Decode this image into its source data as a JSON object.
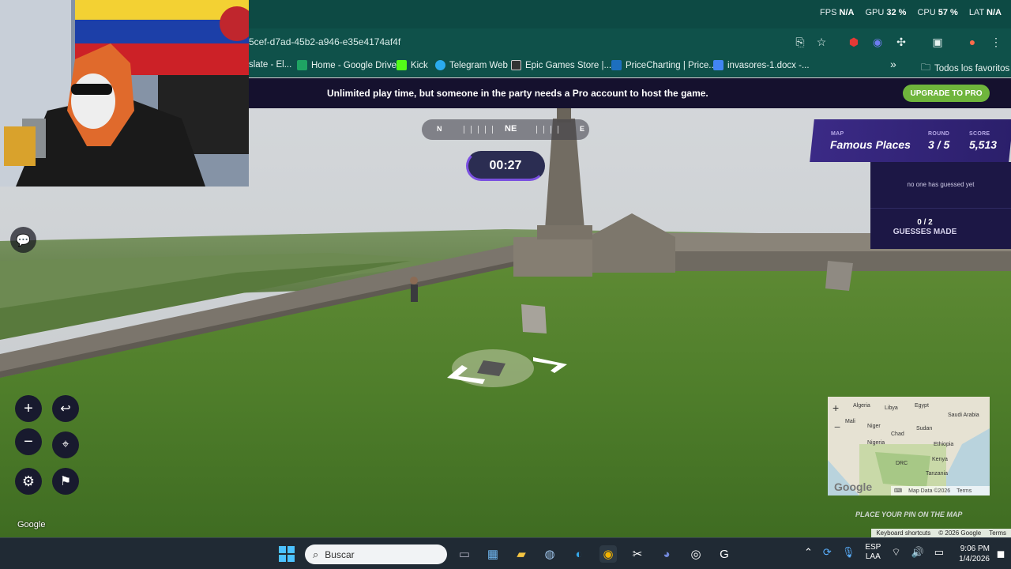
{
  "browser": {
    "url": "5cef-d7ad-45b2-a946-e35e4174af4f",
    "bookmarks": [
      {
        "label": "slate - El...",
        "icon": "bookmark-icon",
        "color": "#888888"
      },
      {
        "label": "Home - Google Drive",
        "icon": "google-drive-icon",
        "color": "#1fa463"
      },
      {
        "label": "Kick",
        "icon": "kick-icon",
        "color": "#53fc18"
      },
      {
        "label": "Telegram Web",
        "icon": "telegram-icon",
        "color": "#2aabee"
      },
      {
        "label": "Epic Games Store |...",
        "icon": "epic-games-icon",
        "color": "#333333"
      },
      {
        "label": "PriceCharting | Price...",
        "icon": "pricecharting-icon",
        "color": "#1d6fbf"
      },
      {
        "label": "invasores-1.docx -...",
        "icon": "docs-icon",
        "color": "#4285f4"
      }
    ],
    "more_label": "»",
    "all_favorites_label": "Todos los favoritos"
  },
  "perf": {
    "fps_label": "FPS",
    "fps_value": "N/A",
    "gpu_label": "GPU",
    "gpu_value": "32 %",
    "cpu_label": "CPU",
    "cpu_value": "57 %",
    "lat_label": "LAT",
    "lat_value": "N/A"
  },
  "game": {
    "banner_text": "Unlimited play time, but someone in the party needs a Pro account to host the game.",
    "upgrade_label": "UPGRADE TO PRO",
    "compass": {
      "n": "N",
      "ne": "NE",
      "e": "E"
    },
    "timer": "00:27",
    "map_label": "MAP",
    "map_value": "Famous Places",
    "round_label": "ROUND",
    "round_value": "3 / 5",
    "score_label": "SCORE",
    "score_value": "5,513",
    "no_guess_text": "no one has guessed yet",
    "guesses_count": "0 / 2",
    "guesses_label": "GUESSES MADE",
    "place_pin_text": "PLACE YOUR PIN ON THE MAP",
    "controls": {
      "zoom_in": "+",
      "zoom_out": "−",
      "back": "↩"
    }
  },
  "streetview": {
    "google_logo": "Google",
    "keyboard_shortcuts": "Keyboard shortcuts",
    "copyright": "© 2026 Google",
    "terms": "Terms"
  },
  "minimap": {
    "labels": [
      "Algeria",
      "Libya",
      "Egypt",
      "Saudi Arabia",
      "Mali",
      "Niger",
      "Chad",
      "Sudan",
      "Nigeria",
      "Ethiopia",
      "Kenya",
      "DRC",
      "Tanzania"
    ],
    "google": "Google",
    "map_data": "Map Data ©2026",
    "terms": "Terms",
    "zoom_in": "+",
    "zoom_out": "−"
  },
  "taskbar": {
    "search_label": "Buscar",
    "lang_top": "ESP",
    "lang_bottom": "LAA",
    "time": "9:06 PM",
    "date": "1/4/2026"
  }
}
